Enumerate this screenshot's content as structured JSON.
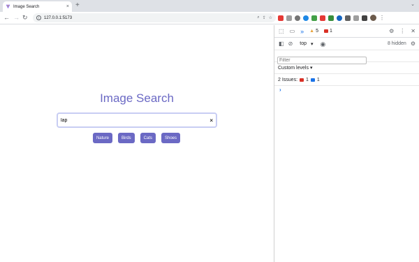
{
  "browser": {
    "tab_title": "Image Search",
    "tab_close": "×",
    "new_tab": "+",
    "url": "127.0.0.1:5173",
    "nav": {
      "back": "←",
      "forward": "→",
      "reload": "↻"
    }
  },
  "app": {
    "title": "Image Search",
    "search": {
      "value": "lap",
      "clear_label": "×"
    },
    "chips": [
      "Nature",
      "Birds",
      "Cats",
      "Shoes"
    ],
    "colors": {
      "accent": "#6b69c4",
      "input_border": "#c8cdf3"
    }
  },
  "devtools": {
    "more_tabs": "»",
    "warnings_count": "5",
    "errors_count": "1",
    "context": "top",
    "hidden": "8 hidden",
    "filter_placeholder": "Filter",
    "levels": "Custom levels",
    "issues": {
      "label": "2 Issues:",
      "errors": "1",
      "info": "1"
    },
    "prompt": "›"
  }
}
